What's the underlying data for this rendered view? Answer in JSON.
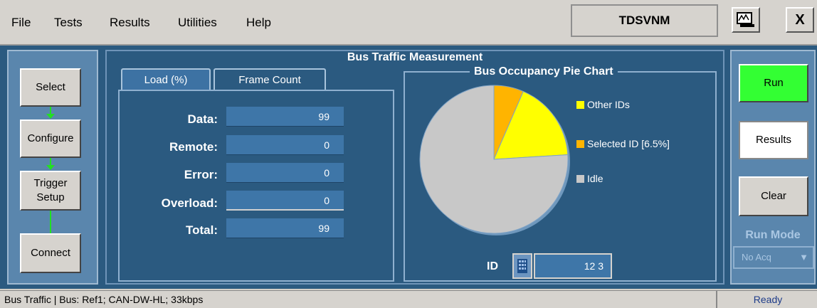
{
  "menu": {
    "file": "File",
    "tests": "Tests",
    "results": "Results",
    "utilities": "Utilities",
    "help": "Help"
  },
  "app_title": "TDSVNM",
  "close_label": "X",
  "workflow": {
    "select": "Select",
    "configure": "Configure",
    "trigger_line1": "Trigger",
    "trigger_line2": "Setup",
    "connect": "Connect"
  },
  "panel_title": "Bus Traffic Measurement",
  "tabs": {
    "load": "Load (%)",
    "frame_count": "Frame Count"
  },
  "rows": [
    {
      "label": "Data:",
      "value": "99"
    },
    {
      "label": "Remote:",
      "value": "0"
    },
    {
      "label": "Error:",
      "value": "0"
    },
    {
      "label": "Overload:",
      "value": "0"
    },
    {
      "label": "Total:",
      "value": "99"
    }
  ],
  "pie": {
    "title": "Bus Occupancy Pie Chart",
    "legend": [
      {
        "label": "Other IDs",
        "color": "#ffff00"
      },
      {
        "label": "Selected ID [6.5%]",
        "color": "#ffb400"
      },
      {
        "label": "Idle",
        "color": "#c8c8c8"
      }
    ],
    "slices": [
      {
        "name": "Selected ID",
        "percent": 6.5,
        "color": "#ffb400"
      },
      {
        "name": "Other IDs",
        "percent": 17.5,
        "color": "#ffff00"
      },
      {
        "name": "Idle",
        "percent": 76,
        "color": "#c8c8c8"
      }
    ]
  },
  "id_field": {
    "label": "ID",
    "value": "12 3"
  },
  "controls": {
    "run": "Run",
    "results": "Results",
    "clear": "Clear",
    "run_mode_label": "Run Mode",
    "run_mode_value": "No Acq"
  },
  "status": {
    "left": "Bus Traffic  |  Bus: Ref1; CAN-DW-HL; 33kbps",
    "right": "Ready"
  },
  "colors": {
    "run_button": "#33ff33",
    "panel_bg": "#2b5a80",
    "arrow": "#22e022"
  }
}
